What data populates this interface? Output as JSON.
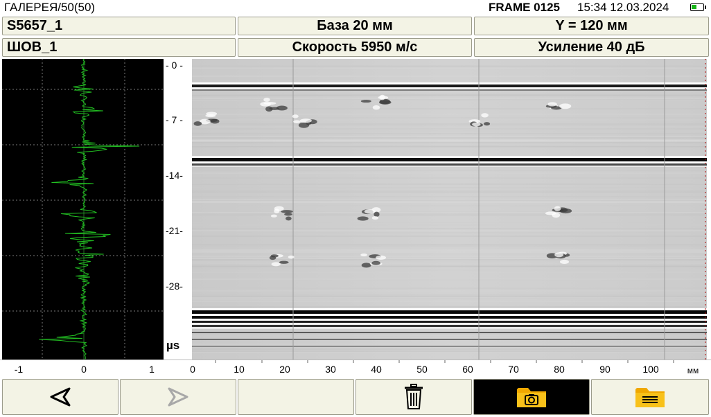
{
  "status": {
    "gallery": "ГАЛЕРЕЯ/50(50)",
    "frame": "FRAME 0125",
    "time": "15:34",
    "date": "12.03.2024"
  },
  "info": {
    "name": "S5657_1",
    "base": "База  20 мм",
    "y_pos": "Y = 120 мм",
    "weld": "ШОВ_1",
    "speed": "Скорость  5950 м/с",
    "gain": "Усиление  40 дБ"
  },
  "ascan": {
    "x_ticks": [
      "-1",
      "0",
      "1"
    ],
    "grid": true,
    "trace_color": "#22c022"
  },
  "time_axis": {
    "ticks": [
      "- 0 -",
      "- 7 -",
      "-14-",
      "-21-",
      "-28-"
    ],
    "unit": "µs"
  },
  "distance_axis": {
    "ticks": [
      "0",
      "10",
      "20",
      "30",
      "40",
      "50",
      "60",
      "70",
      "80",
      "90",
      "100"
    ],
    "unit": "мм"
  },
  "toolbar": {
    "prev": "prev-arrow-icon",
    "next": "next-arrow-icon",
    "delete": "trash-icon",
    "snapshot": "folder-camera-icon",
    "list": "folder-list-icon",
    "folder_color": "#f5b800"
  }
}
